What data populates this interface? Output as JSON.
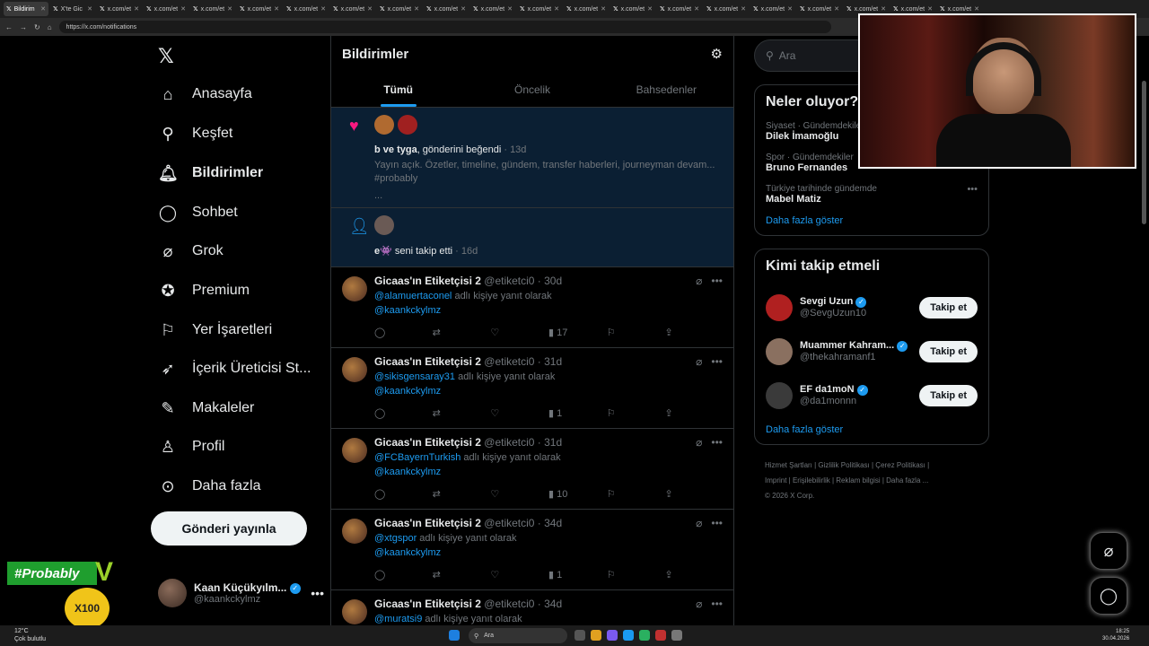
{
  "browser": {
    "tabs": [
      "Bildirim",
      "X'te Gic",
      "x.com/et",
      "x.com/et",
      "x.com/et",
      "x.com/et",
      "x.com/et",
      "x.com/et",
      "x.com/et",
      "x.com/et",
      "x.com/et",
      "x.com/et",
      "x.com/et",
      "x.com/et",
      "x.com/et",
      "x.com/et",
      "x.com/et",
      "x.com/et",
      "x.com/et",
      "x.com/et",
      "x.com/et"
    ],
    "url": "https://x.com/notifications"
  },
  "nav": {
    "items": [
      {
        "label": "Anasayfa",
        "icon": "home-icon"
      },
      {
        "label": "Keşfet",
        "icon": "search-icon"
      },
      {
        "label": "Bildirimler",
        "icon": "bell-icon"
      },
      {
        "label": "Sohbet",
        "icon": "chat-icon"
      },
      {
        "label": "Grok",
        "icon": "grok-icon"
      },
      {
        "label": "Premium",
        "icon": "premium-icon"
      },
      {
        "label": "Yer İşaretleri",
        "icon": "bookmark-icon"
      },
      {
        "label": "İçerik Üreticisi St...",
        "icon": "rocket-icon"
      },
      {
        "label": "Makaleler",
        "icon": "articles-icon"
      },
      {
        "label": "Profil",
        "icon": "profile-icon"
      },
      {
        "label": "Daha fazla",
        "icon": "more-icon"
      }
    ],
    "post_button": "Gönderi yayınla",
    "account": {
      "name": "Kaan Küçükyılm...",
      "handle": "@kaankckylmz"
    }
  },
  "main": {
    "title": "Bildirimler",
    "tabs": [
      "Tümü",
      "Öncelik",
      "Bahsedenler"
    ],
    "like_notif": {
      "actor": "b ve tyga",
      "text": ", gönderini beğendi",
      "time": "13d",
      "body": "Yayın açık. Özetler, timeline, gündem, transfer haberleri, journeyman devam... #probably",
      "ellipsis": "..."
    },
    "follow_notif": {
      "actor": "e👾",
      "text": " seni takip etti",
      "time": "16d"
    },
    "posts": [
      {
        "name": "Gicaas'ın Etiketçisi 2",
        "handle": "@etiketci0 · 30d",
        "mention": "@alamuertaconel",
        "reply": " adlı kişiye yanıt olarak",
        "tag": "@kaankckylmz",
        "views": "17"
      },
      {
        "name": "Gicaas'ın Etiketçisi 2",
        "handle": "@etiketci0 · 31d",
        "mention": "@sikisgensaray31",
        "reply": " adlı kişiye yanıt olarak",
        "tag": "@kaankckylmz",
        "views": "1"
      },
      {
        "name": "Gicaas'ın Etiketçisi 2",
        "handle": "@etiketci0 · 31d",
        "mention": "@FCBayernTurkish",
        "reply": " adlı kişiye yanıt olarak",
        "tag": "@kaankckylmz",
        "views": "10"
      },
      {
        "name": "Gicaas'ın Etiketçisi 2",
        "handle": "@etiketci0 · 34d",
        "mention": "@xtgspor",
        "reply": " adlı kişiye yanıt olarak",
        "tag": "@kaankckylmz",
        "views": "1"
      },
      {
        "name": "Gicaas'ın Etiketçisi 2",
        "handle": "@etiketci0 · 34d",
        "mention": "@muratsi9",
        "reply": " adlı kişiye yanıt olarak",
        "tag": "",
        "views": ""
      }
    ]
  },
  "right": {
    "search_placeholder": "Ara",
    "trends_title": "Neler oluyor?",
    "trends": [
      {
        "cat": "Siyaset · Gündemdekiler",
        "title": "Dilek İmamoğlu"
      },
      {
        "cat": "Spor · Gündemdekiler",
        "title": "Bruno Fernandes"
      },
      {
        "cat": "Türkiye tarihinde gündemde",
        "title": "Mabel Matiz"
      }
    ],
    "show_more": "Daha fazla göster",
    "who_title": "Kimi takip etmeli",
    "who": [
      {
        "name": "Sevgi Uzun",
        "handle": "@SevgUzun10",
        "button": "Takip et"
      },
      {
        "name": "Muammer Kahram...",
        "handle": "@thekahramanf1",
        "button": "Takip et"
      },
      {
        "name": "EF da1moN",
        "handle": "@da1monnn",
        "button": "Takip et"
      }
    ],
    "footer_line1": "Hizmet Şartları | Gizlilik Politikası | Çerez Politikası |",
    "footer_line2": "Imprint | Erişilebilirlik | Reklam bilgisi | Daha fazla ...",
    "footer_line3": "© 2026 X Corp."
  },
  "overlay": {
    "tag": "#Probably",
    "coin": "X100"
  },
  "taskbar": {
    "temp": "12°C",
    "weather": "Çok bulutlu",
    "search": "Ara",
    "time": "18:25",
    "date": "30.04.2026"
  }
}
